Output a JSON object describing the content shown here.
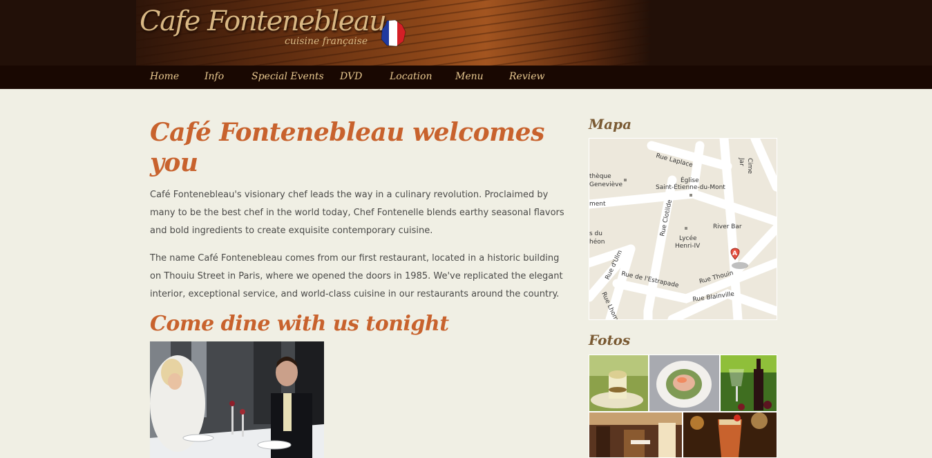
{
  "header": {
    "title": "Cafe Fontenebleau",
    "subtitle": "cuisine française",
    "flag_icon": "france-map-flag-icon"
  },
  "nav": {
    "items": [
      "Home",
      "Info",
      "Special Events",
      "DVD",
      "Location",
      "Menu",
      "Review"
    ]
  },
  "main": {
    "heading": "Café Fontenebleau welcomes you",
    "paragraphs": [
      "Café Fontenebleau's visionary chef leads the way in a culinary revolution. Proclaimed by many to be the best chef in the world today, Chef Fontenelle blends earthy seasonal flavors and bold ingredients to create exquisite contemporary cuisine.",
      "The name Café Fontenebleau comes from our first restaurant, located in a historic building on Thouiu Street in Paris, where we opened the doors in 1985. We've replicated the elegant interior, exceptional service, and world-class cuisine in our restaurants around the country."
    ],
    "subheading": "Come dine with us tonight"
  },
  "sidebar": {
    "map_title": "Mapa",
    "map": {
      "labels": [
        "Rue Laplace",
        "Église",
        "Saint-Étienne-du-Mont",
        "thèque",
        "Geneviève",
        "ment",
        "Rue Clotilde",
        "Lycée",
        "Henri-IV",
        "River Bar",
        "Rue Thouin",
        "Rue de l'Estrapade",
        "Rue Blainville",
        "Rue d'Ulm",
        "Rue Lhom",
        "Cime",
        "Jar",
        "s du",
        "héon"
      ],
      "marker_label": "A"
    },
    "photos_title": "Fotos"
  },
  "colors": {
    "accent": "#c8622d",
    "nav_text": "#e8c88f",
    "page_bg": "#f0efe4",
    "header_bg": "#221008",
    "sidebar_title": "#7a5a33"
  }
}
